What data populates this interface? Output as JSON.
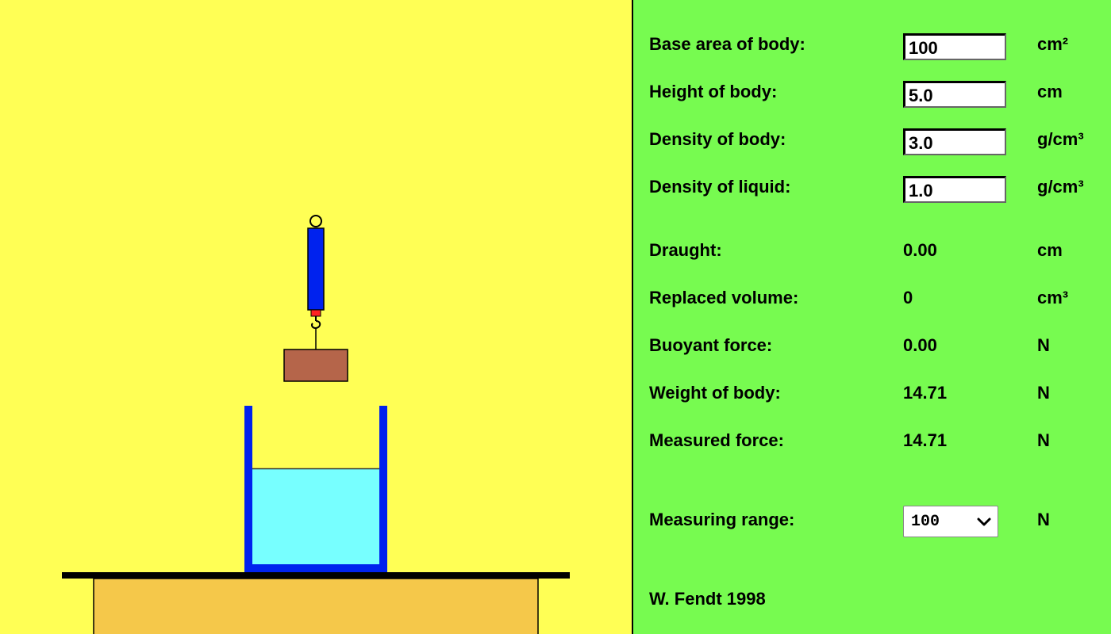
{
  "inputs": [
    {
      "label": "Base area of body:",
      "value": "100",
      "unit": "cm²"
    },
    {
      "label": "Height of body:",
      "value": "5.0",
      "unit": "cm"
    },
    {
      "label": "Density of body:",
      "value": "3.0",
      "unit": "g/cm³"
    },
    {
      "label": "Density of liquid:",
      "value": "1.0",
      "unit": "g/cm³"
    }
  ],
  "outputs": [
    {
      "label": "Draught:",
      "value": "0.00",
      "unit": "cm"
    },
    {
      "label": "Replaced volume:",
      "value": "0",
      "unit": "cm³"
    },
    {
      "label": "Buoyant force:",
      "value": "0.00",
      "unit": "N"
    },
    {
      "label": "Weight of body:",
      "value": "14.71",
      "unit": "N"
    },
    {
      "label": "Measured force:",
      "value": "14.71",
      "unit": "N"
    }
  ],
  "range": {
    "label": "Measuring range:",
    "selected": "100",
    "unit": "N"
  },
  "credit": "W. Fendt 1998",
  "colors": {
    "canvas_bg": "#ffff55",
    "panel_bg": "#77fb50",
    "spring_scale": "#0022ee",
    "body_block": "#b5654a",
    "liquid": "#77ffff",
    "beaker": "#0022ee",
    "table_top": "#f5c84a"
  },
  "icons": [
    "ring-icon",
    "hook-icon",
    "chevron-down-icon"
  ]
}
